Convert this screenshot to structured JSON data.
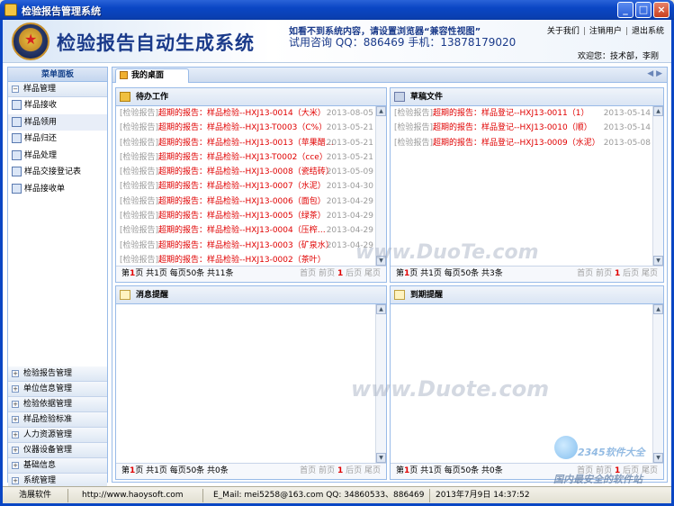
{
  "window": {
    "title": "检验报告管理系统"
  },
  "banner": {
    "system_title": "检验报告自动生成系统",
    "notice": "如看不到系统内容，请设置浏览器“兼容性视图”",
    "contact": "试用咨询 QQ：886469 手机：13878179020",
    "links": {
      "about": "关于我们",
      "logout_user": "注销用户",
      "exit": "退出系统"
    },
    "welcome": "欢迎您：技术部，李刚"
  },
  "sidebar": {
    "header": "菜单面板",
    "top_group": "样品管理",
    "items": [
      {
        "label": "样品接收",
        "icon": "sample-receive-icon"
      },
      {
        "label": "样品领用",
        "icon": "sample-use-icon"
      },
      {
        "label": "样品归还",
        "icon": "sample-return-icon"
      },
      {
        "label": "样品处理",
        "icon": "sample-process-icon"
      },
      {
        "label": "样品交接登记表",
        "icon": "register-table-icon"
      },
      {
        "label": "样品接收单",
        "icon": "receipt-icon"
      }
    ],
    "groups": [
      "检验报告管理",
      "单位信息管理",
      "检验依据管理",
      "样品检验标准",
      "人力资源管理",
      "仪器设备管理",
      "基础信息",
      "系统管理"
    ]
  },
  "tabs": {
    "active": "我的桌面"
  },
  "todo": {
    "title": "待办工作",
    "rows": [
      {
        "tag": "[检验报告]",
        "text": "超期的报告：样品检验--HXJ13-0014（大米）",
        "date": "2013-08-05"
      },
      {
        "tag": "[检验报告]",
        "text": "超期的报告：样品检验--HXJ13-T0003（C%）",
        "date": "2013-05-21"
      },
      {
        "tag": "[检验报告]",
        "text": "超期的报告：样品检验--HXJ13-0013（苹果醋…",
        "date": "2013-05-21"
      },
      {
        "tag": "[检验报告]",
        "text": "超期的报告：样品检验--HXJ13-T0002（cce）",
        "date": "2013-05-21"
      },
      {
        "tag": "[检验报告]",
        "text": "超期的报告：样品检验--HXJ13-0008（瓷结砖）",
        "date": "2013-05-09"
      },
      {
        "tag": "[检验报告]",
        "text": "超期的报告：样品检验--HXJ13-0007（水泥）",
        "date": "2013-04-30"
      },
      {
        "tag": "[检验报告]",
        "text": "超期的报告：样品检验--HXJ13-0006（面包）",
        "date": "2013-04-29"
      },
      {
        "tag": "[检验报告]",
        "text": "超期的报告：样品检验--HXJ13-0005（绿茶）",
        "date": "2013-04-29"
      },
      {
        "tag": "[检验报告]",
        "text": "超期的报告：样品检验--HXJ13-0004（压榨…",
        "date": "2013-04-29"
      },
      {
        "tag": "[检验报告]",
        "text": "超期的报告：样品检验--HXJ13-0003（矿泉水）",
        "date": "2013-04-29"
      },
      {
        "tag": "[检验报告]",
        "text": "超期的报告：样品检验--HXJ13-0002（茶叶）",
        "date": ""
      }
    ],
    "pager": {
      "page_prefix": "第",
      "page_num": "1",
      "page_suffix": "页 共1页 每页50条 共11条",
      "nav": {
        "first": "首页",
        "prev": "前页",
        "current": "1",
        "next": "后页",
        "last": "尾页"
      }
    }
  },
  "drafts": {
    "title": "草稿文件",
    "rows": [
      {
        "tag": "[检验报告]",
        "text": "超期的报告：样品登记--HXJ13-0011（1）",
        "date": "2013-05-14"
      },
      {
        "tag": "[检验报告]",
        "text": "超期的报告：样品登记--HXJ13-0010（顺）",
        "date": "2013-05-14"
      },
      {
        "tag": "[检验报告]",
        "text": "超期的报告：样品登记--HXJ13-0009（水泥）",
        "date": "2013-05-08"
      }
    ],
    "pager": {
      "page_prefix": "第",
      "page_num": "1",
      "page_suffix": "页 共1页 每页50条 共3条",
      "nav": {
        "first": "首页",
        "prev": "前页",
        "current": "1",
        "next": "后页",
        "last": "尾页"
      }
    }
  },
  "messages": {
    "title": "消息提醒",
    "pager": {
      "page_prefix": "第",
      "page_num": "1",
      "page_suffix": "页 共1页 每页50条 共0条",
      "nav": {
        "first": "首页",
        "prev": "前页",
        "current": "1",
        "next": "后页",
        "last": "尾页"
      }
    }
  },
  "due": {
    "title": "到期提醒",
    "pager": {
      "page_prefix": "第",
      "page_num": "1",
      "page_suffix": "页 共1页 每页50条 共0条",
      "nav": {
        "first": "首页",
        "prev": "前页",
        "current": "1",
        "next": "后页",
        "last": "尾页"
      }
    }
  },
  "statusbar": {
    "company": "浩展软件",
    "url": "http://www.haoysoft.com",
    "email": "E_Mail: mei5258@163.com  QQ: 34860533、886469",
    "datetime": "2013年7月9日  14:37:52"
  },
  "watermarks": {
    "w1": "www.DuoTe.com",
    "w2": "www.Duote.com",
    "w3": "2345软件大全",
    "w4": "国内最安全的软件站"
  }
}
